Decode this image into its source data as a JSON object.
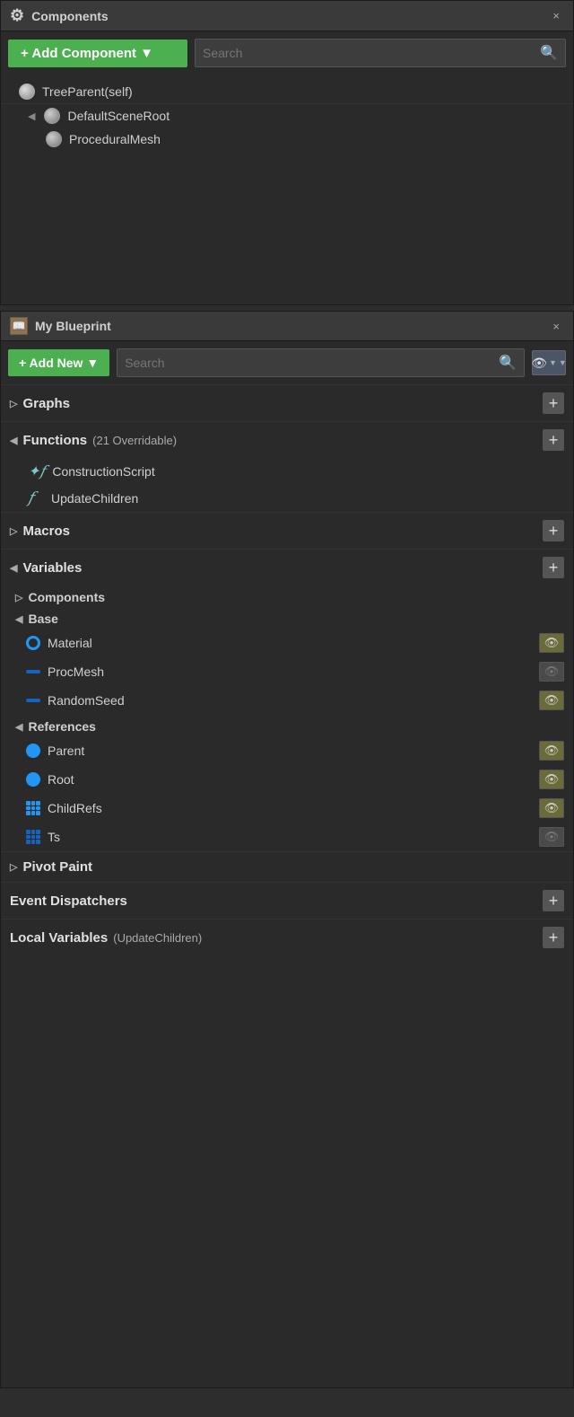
{
  "components_panel": {
    "title": "Components",
    "close_label": "×",
    "add_component_label": "+ Add Component ▼",
    "search_placeholder": "Search",
    "tree": [
      {
        "label": "TreeParent(self)",
        "type": "sphere",
        "indent": 0
      },
      {
        "label": "DefaultSceneRoot",
        "type": "gear-sphere",
        "indent": 0,
        "arrow": "◀"
      },
      {
        "label": "ProceduralMesh",
        "type": "gear-sphere",
        "indent": 1
      }
    ]
  },
  "blueprint_panel": {
    "title": "My Blueprint",
    "close_label": "×",
    "add_new_label": "+ Add New ▼",
    "search_placeholder": "Search",
    "sections": {
      "graphs": {
        "label": "Graphs",
        "arrow": "▷",
        "add": "+"
      },
      "functions": {
        "label": "Functions",
        "badge": "(21 Overridable)",
        "arrow": "◀",
        "add": "+",
        "items": [
          {
            "label": "ConstructionScript",
            "type": "construction"
          },
          {
            "label": "UpdateChildren",
            "type": "function"
          }
        ]
      },
      "macros": {
        "label": "Macros",
        "arrow": "▷",
        "add": "+"
      },
      "variables": {
        "label": "Variables",
        "arrow": "◀",
        "add": "+",
        "subsections": [
          {
            "label": "Components",
            "arrow": "▷"
          },
          {
            "label": "Base",
            "arrow": "◀",
            "items": [
              {
                "label": "Material",
                "dot_type": "ring-blue",
                "eye": true
              },
              {
                "label": "ProcMesh",
                "dot_type": "dash-dark",
                "eye": false
              },
              {
                "label": "RandomSeed",
                "dot_type": "dash-dark",
                "eye": true
              }
            ]
          },
          {
            "label": "References",
            "arrow": "◀",
            "items": [
              {
                "label": "Parent",
                "dot_type": "circle-blue",
                "eye": true
              },
              {
                "label": "Root",
                "dot_type": "circle-blue",
                "eye": true
              },
              {
                "label": "ChildRefs",
                "dot_type": "grid-blue",
                "eye": true
              },
              {
                "label": "Ts",
                "dot_type": "grid-dark",
                "eye": false
              }
            ]
          }
        ]
      }
    },
    "pivot_paint": {
      "label": "Pivot Paint",
      "arrow": "▷"
    },
    "event_dispatchers": {
      "label": "Event Dispatchers",
      "add": "+"
    },
    "local_variables": {
      "label": "Local Variables",
      "badge": "(UpdateChildren)",
      "add": "+"
    }
  },
  "icons": {
    "search": "🔍",
    "eye": "👁",
    "eye_closed": "👁",
    "plus": "+",
    "close": "×"
  }
}
